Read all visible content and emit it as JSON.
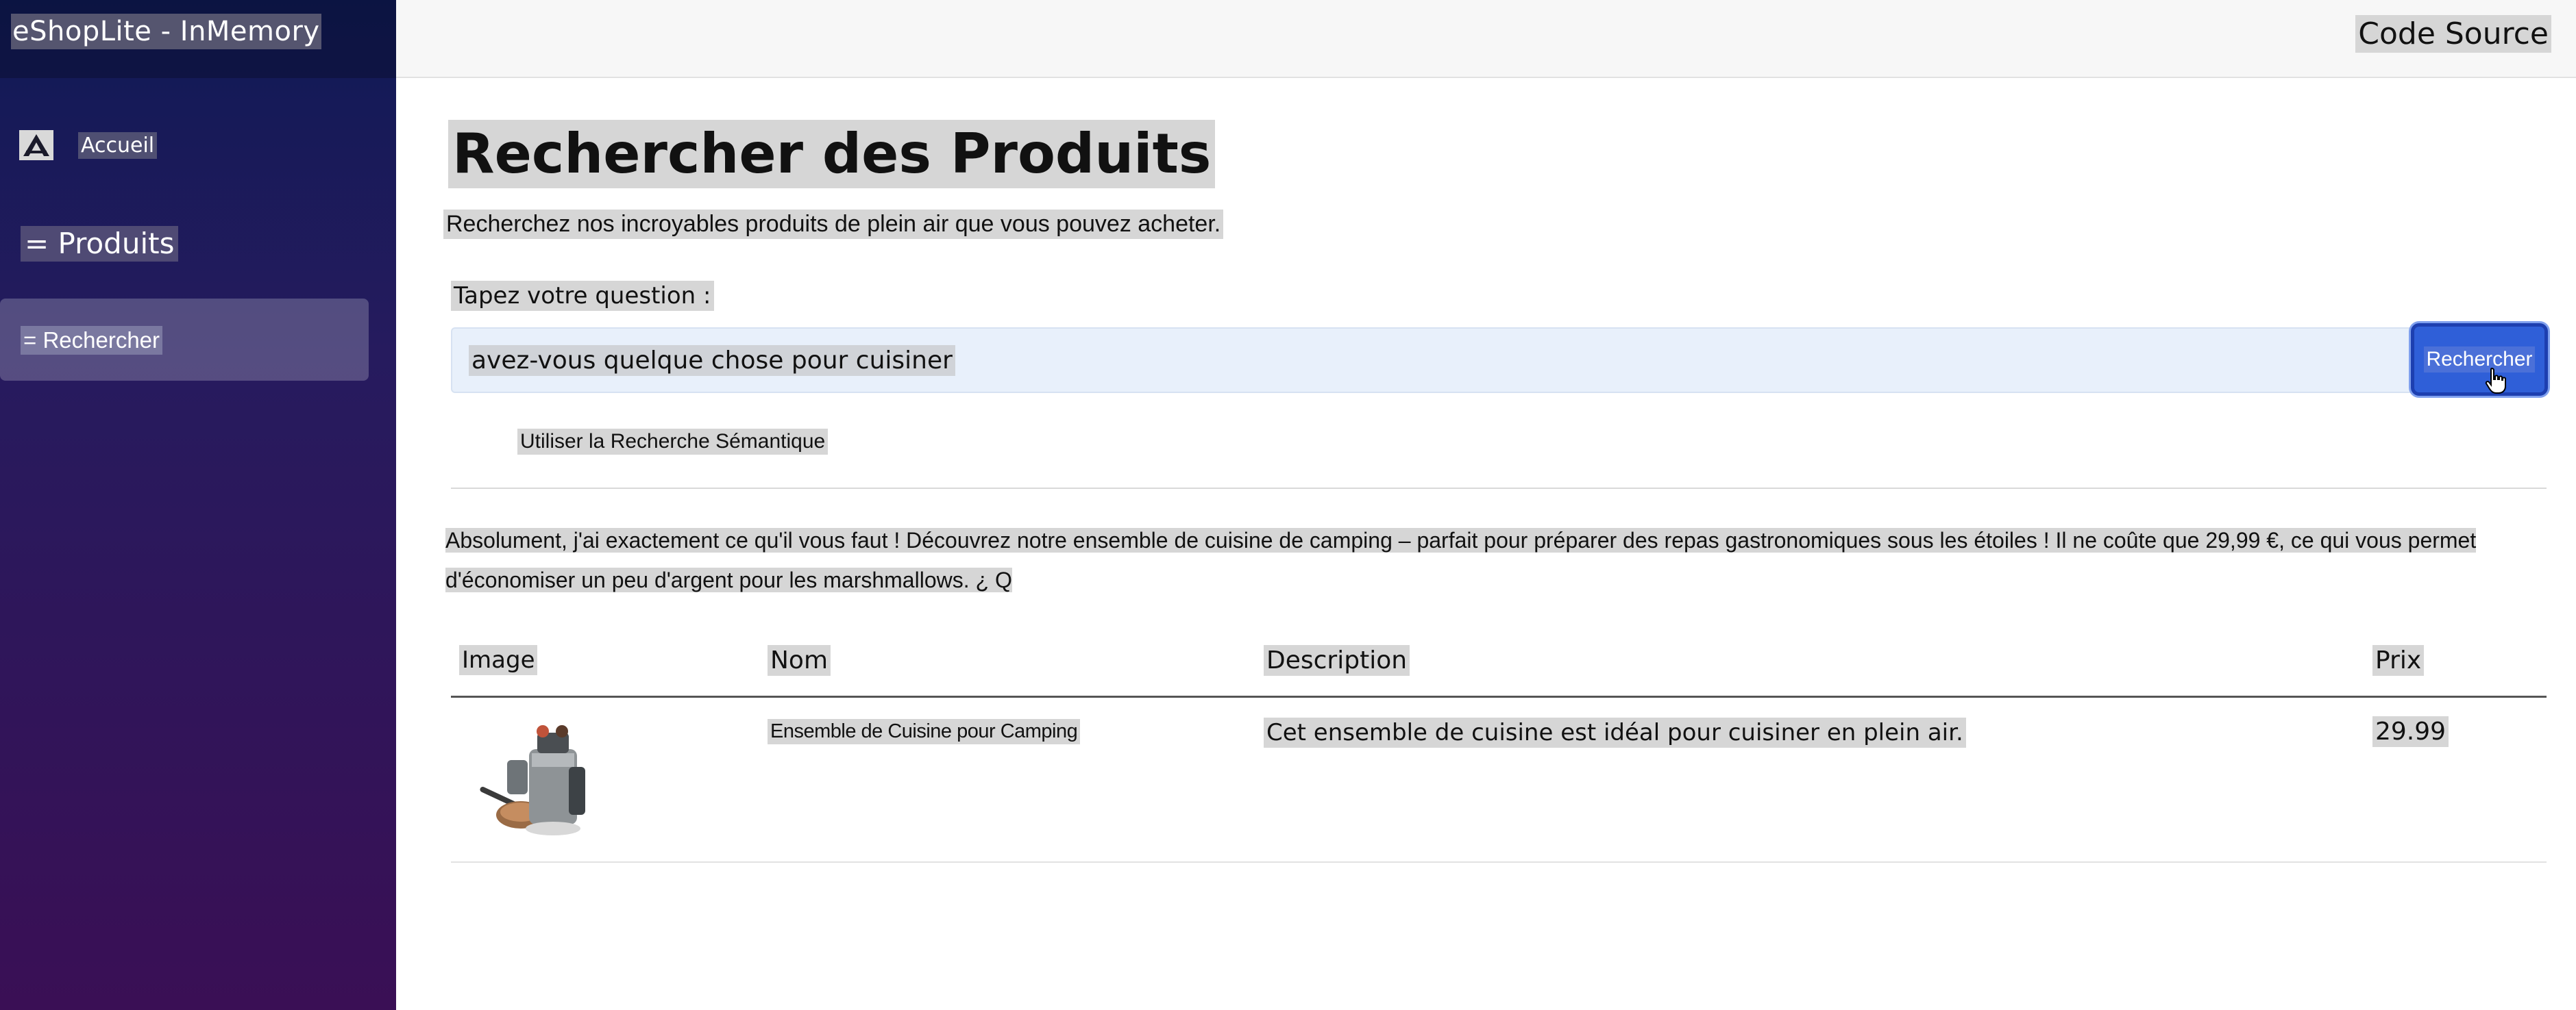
{
  "app": {
    "brand": "eShopLite - InMemory",
    "code_source": "Code Source"
  },
  "sidebar": {
    "items": [
      {
        "label": "Accueil",
        "icon": "home-icon"
      },
      {
        "label": "= Produits"
      },
      {
        "label": "= Rechercher"
      }
    ]
  },
  "main": {
    "title": "Rechercher des Produits",
    "subtitle": "Recherchez nos incroyables produits de plein air que vous pouvez acheter.",
    "question_label": "Tapez votre question :",
    "search_value": "avez-vous quelque chose pour cuisiner",
    "search_button": "Rechercher",
    "semantic_label": "Utiliser la Recherche Sémantique",
    "answer": "Absolument, j'ai exactement ce qu'il vous faut ! Découvrez notre ensemble de cuisine de camping – parfait pour préparer des repas gastronomiques sous les étoiles ! Il ne coûte que 29,99 €, ce qui vous permet d'économiser un peu d'argent pour les marshmallows. ¿ Q"
  },
  "table": {
    "headers": [
      "Image",
      "Nom",
      "Description",
      "Prix"
    ],
    "rows": [
      {
        "image": "camping-cookware-image",
        "name": "Ensemble de Cuisine pour Camping",
        "description": "Cet ensemble de cuisine est idéal pour cuisiner en plein air.",
        "price": "29.99"
      }
    ]
  },
  "colors": {
    "sidebar_top": "#0f1a55",
    "sidebar_bottom": "#3a0f55",
    "button": "#2f5fd8",
    "input_bg": "#e8f0fb"
  }
}
